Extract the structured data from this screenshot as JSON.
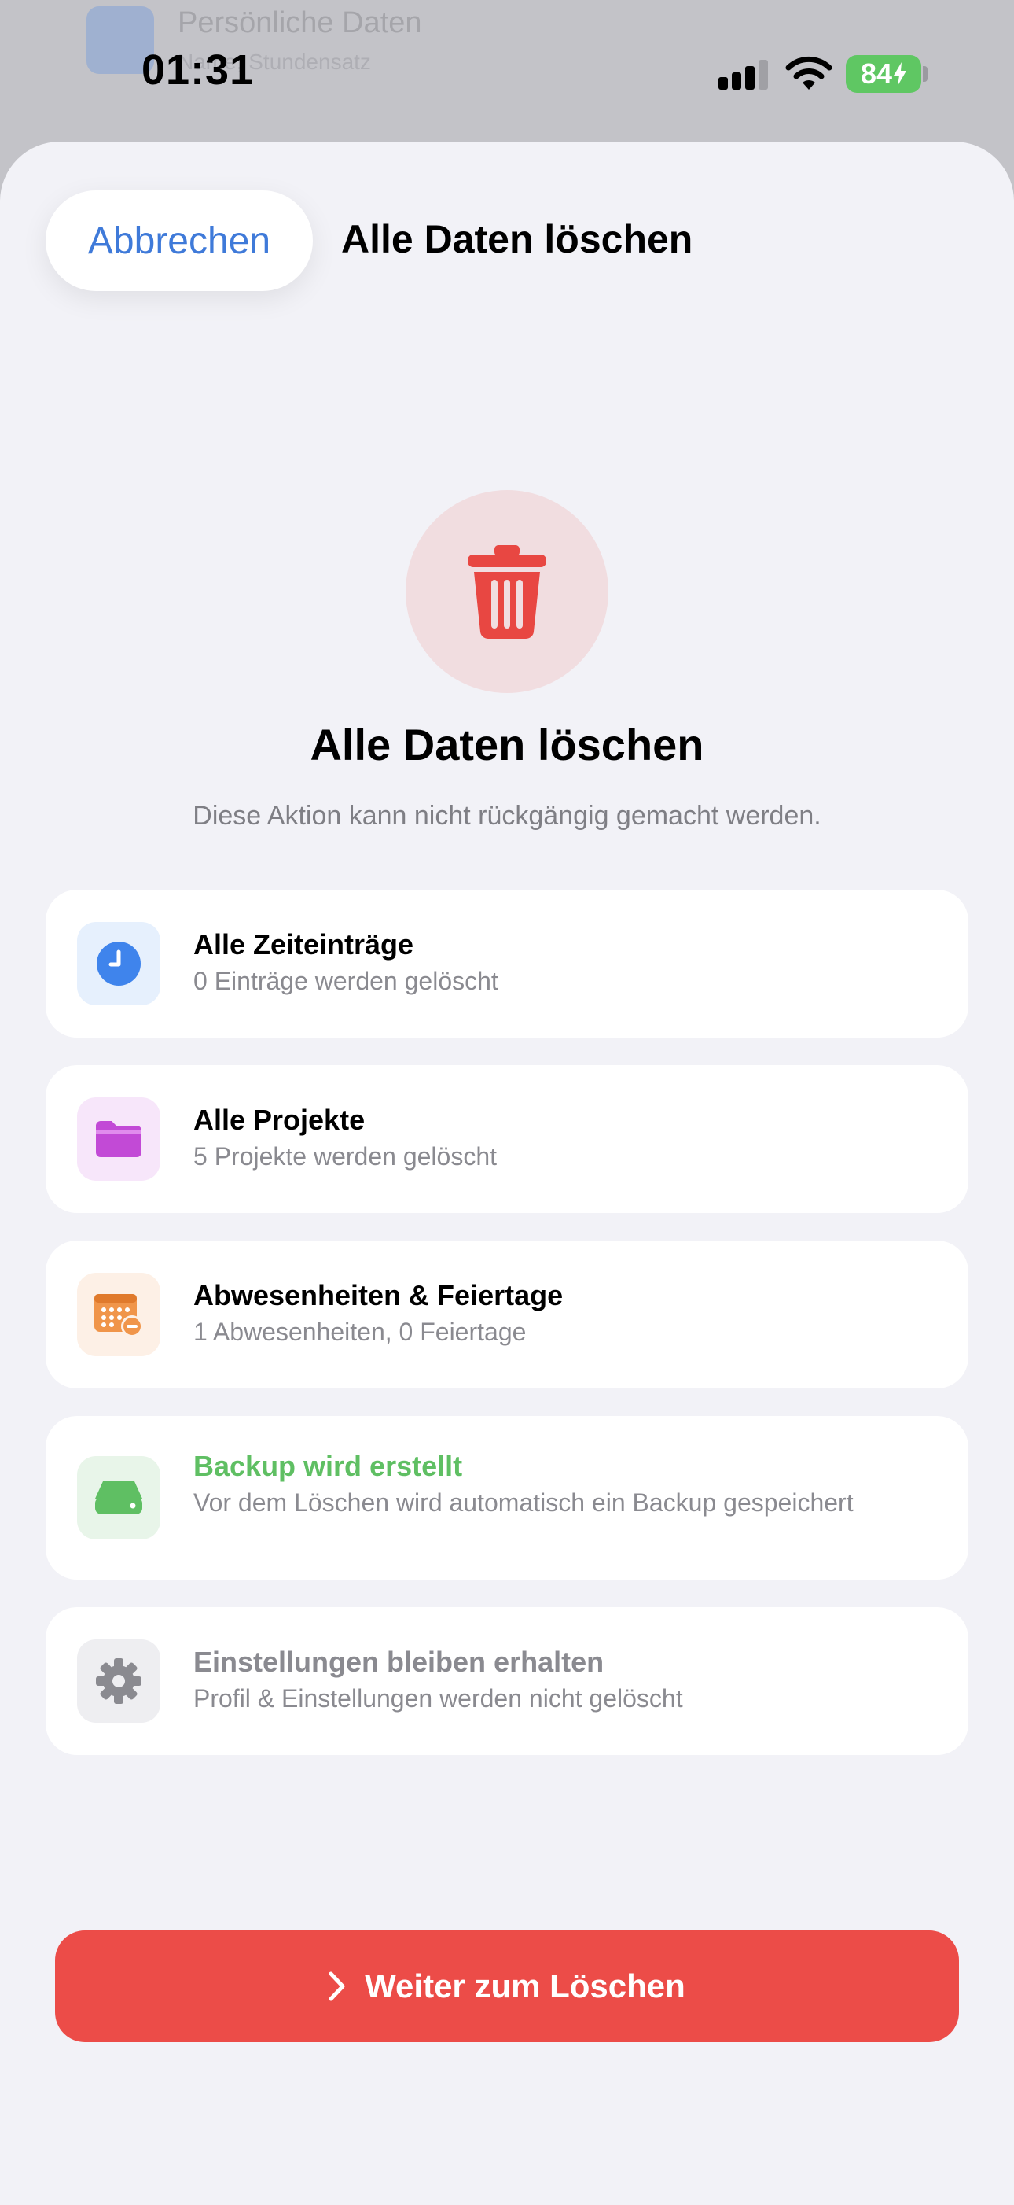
{
  "background": {
    "title": "Persönliche Daten",
    "subtitle": "Name, Stundensatz"
  },
  "status_bar": {
    "time": "01:31",
    "battery": "84"
  },
  "nav": {
    "cancel_label": "Abbrechen",
    "title": "Alle Daten löschen"
  },
  "hero": {
    "icon": "trash-icon",
    "title": "Alle Daten löschen",
    "subtitle": "Diese Aktion kann nicht rückgängig gemacht werden."
  },
  "items": [
    {
      "icon": "clock-icon",
      "title": "Alle Zeiteinträge",
      "subtitle": "0 Einträge werden gelöscht",
      "title_color": "#000000",
      "icon_bg": "#e6f0fd",
      "icon_color": "#3f84ec"
    },
    {
      "icon": "folder-icon",
      "title": "Alle Projekte",
      "subtitle": "5 Projekte werden gelöscht",
      "title_color": "#000000",
      "icon_bg": "#f7e6fa",
      "icon_color": "#c24ad6"
    },
    {
      "icon": "calendar-minus-icon",
      "title": "Abwesenheiten & Feiertage",
      "subtitle": "1 Abwesenheiten, 0 Feiertage",
      "title_color": "#000000",
      "icon_bg": "#fdf0e6",
      "icon_color": "#f0954a"
    },
    {
      "icon": "drive-icon",
      "title": "Backup wird erstellt",
      "subtitle": "Vor dem Löschen wird automatisch ein Backup gespeichert",
      "title_color": "#5fbf63",
      "icon_bg": "#e8f5e9",
      "icon_color": "#5fbf63"
    },
    {
      "icon": "gear-icon",
      "title": "Einstellungen bleiben erhalten",
      "subtitle": "Profil & Einstellungen werden nicht gelöscht",
      "title_color": "#8a8a90",
      "icon_bg": "#eeeef1",
      "icon_color": "#8a8a90"
    }
  ],
  "action": {
    "icon": "chevron-right-icon",
    "label": "Weiter zum Löschen",
    "color": "#ec4c48"
  }
}
